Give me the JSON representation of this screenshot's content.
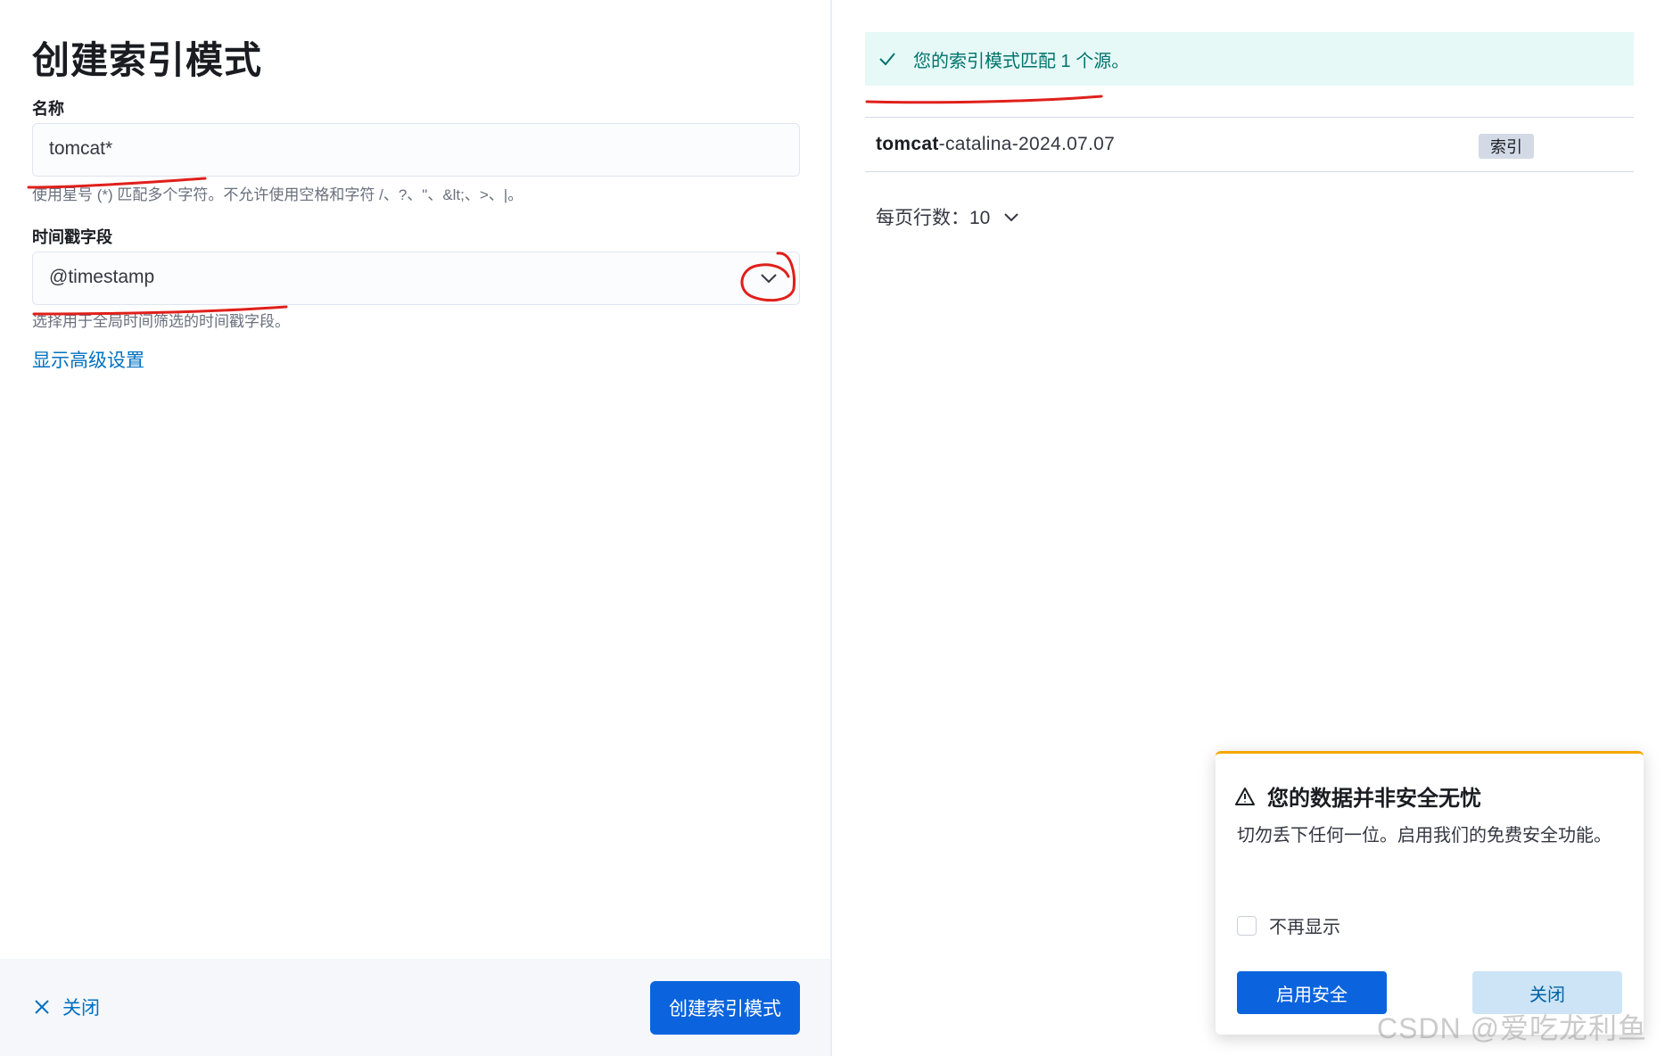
{
  "form": {
    "title": "创建索引模式",
    "name_label": "名称",
    "name_value": "tomcat*",
    "name_help": "使用星号 (*) 匹配多个字符。不允许使用空格和字符 /、?、\"、&lt;、>、|。",
    "timestamp_label": "时间戳字段",
    "timestamp_value": "@timestamp",
    "timestamp_help": "选择用于全局时间筛选的时间戳字段。",
    "advanced_link": "显示高级设置"
  },
  "footer": {
    "close_label": "关闭",
    "create_label": "创建索引模式"
  },
  "preview": {
    "match_message": "您的索引模式匹配 1 个源。",
    "index_match_bold": "tomcat",
    "index_match_rest": "-catalina-2024.07.07",
    "index_badge": "索引",
    "rows_per_page": "每页行数：10"
  },
  "toast": {
    "title": "您的数据并非安全无忧",
    "body": "切勿丢下任何一位。启用我们的免费安全功能。",
    "checkbox_label": "不再显示",
    "enable_label": "启用安全",
    "close_label": "关闭"
  },
  "watermark": "CSDN @爱吃龙利鱼",
  "colors": {
    "primary": "#0b64dd",
    "link": "#0071c2",
    "success_bg": "#e6f9f7",
    "success_text": "#00726b",
    "warning_accent": "#f5a700",
    "annotation": "#e0201b"
  },
  "icons": {
    "success": "check-icon",
    "dropdown": "chevron-down-icon",
    "close": "cross-icon",
    "warning": "warning-icon"
  }
}
